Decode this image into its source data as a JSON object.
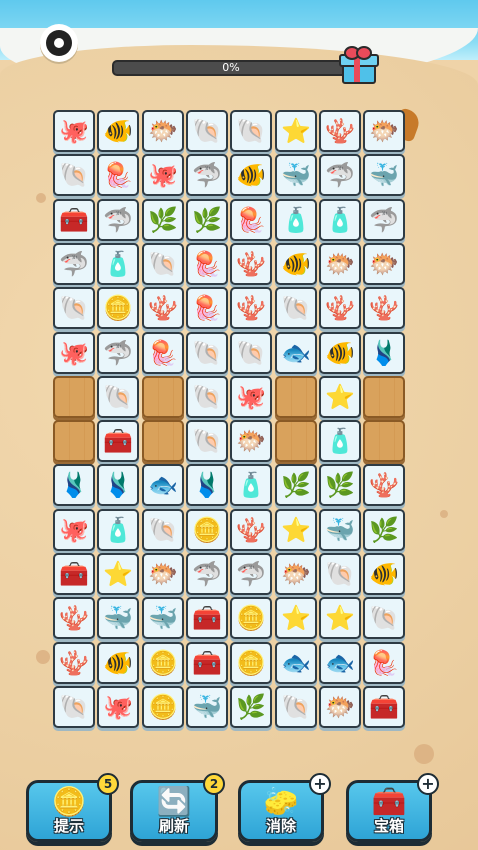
{
  "hud": {
    "progress_text": "0%",
    "progress_value": 0,
    "settings_icon": "gear-icon",
    "reward_icon": "gift-box-icon"
  },
  "board": {
    "rows": [
      [
        "🐙",
        "🐠",
        "🐡",
        "🐚",
        "🐚",
        "⭐",
        "🪸",
        "🐡"
      ],
      [
        "🐚",
        "🪼",
        "🐙",
        "🦈",
        "🐠",
        "🐳",
        "🦈",
        "🐳"
      ],
      [
        "🧰",
        "🦈",
        "🌿",
        "🌿",
        "🪼",
        "🧴",
        "🧴",
        "🦈"
      ],
      [
        "🦈",
        "🧴",
        "🐚",
        "🪼",
        "🪸",
        "🐠",
        "🐡",
        "🐡"
      ],
      [
        "🐚",
        "🪙",
        "🪸",
        "🪼",
        "🪸",
        "🐚",
        "🪸",
        "🪸"
      ],
      [
        "🐙",
        "🦈",
        "🪼",
        "🐚",
        "🐚",
        "🐟",
        "🐠",
        "🩱"
      ],
      [
        "",
        "🐚",
        "",
        "🐚",
        "🐙",
        "",
        "⭐",
        ""
      ],
      [
        "",
        "🧰",
        "",
        "🐚",
        "🐡",
        "",
        "🧴",
        ""
      ],
      [
        "🩱",
        "🩱",
        "🐟",
        "🩱",
        "🧴",
        "🌿",
        "🌿",
        "🪸"
      ],
      [
        "🐙",
        "🧴",
        "🐚",
        "🪙",
        "🪸",
        "⭐",
        "🐳",
        "🌿"
      ],
      [
        "🧰",
        "⭐",
        "🐡",
        "🦈",
        "🦈",
        "🐡",
        "🐚",
        "🐠"
      ],
      [
        "🪸",
        "🐳",
        "🐳",
        "🧰",
        "🪙",
        "⭐",
        "⭐",
        "🐚"
      ],
      [
        "🪸",
        "🐠",
        "🪙",
        "🧰",
        "🪙",
        "🐟",
        "🐟",
        "🪼"
      ],
      [
        "🐚",
        "🐙",
        "🪙",
        "🐳",
        "🌿",
        "🐚",
        "🐡",
        "🧰"
      ]
    ]
  },
  "buttons": {
    "hint": {
      "label": "提示",
      "count": "5",
      "icon": "lightbulb-coin-icon"
    },
    "refresh": {
      "label": "刷新",
      "count": "2",
      "icon": "refresh-arrows-icon"
    },
    "eliminate": {
      "label": "消除",
      "count": "+",
      "icon": "eraser-icon"
    },
    "chest": {
      "label": "宝箱",
      "count": "+",
      "icon": "treasure-chest-icon"
    }
  }
}
